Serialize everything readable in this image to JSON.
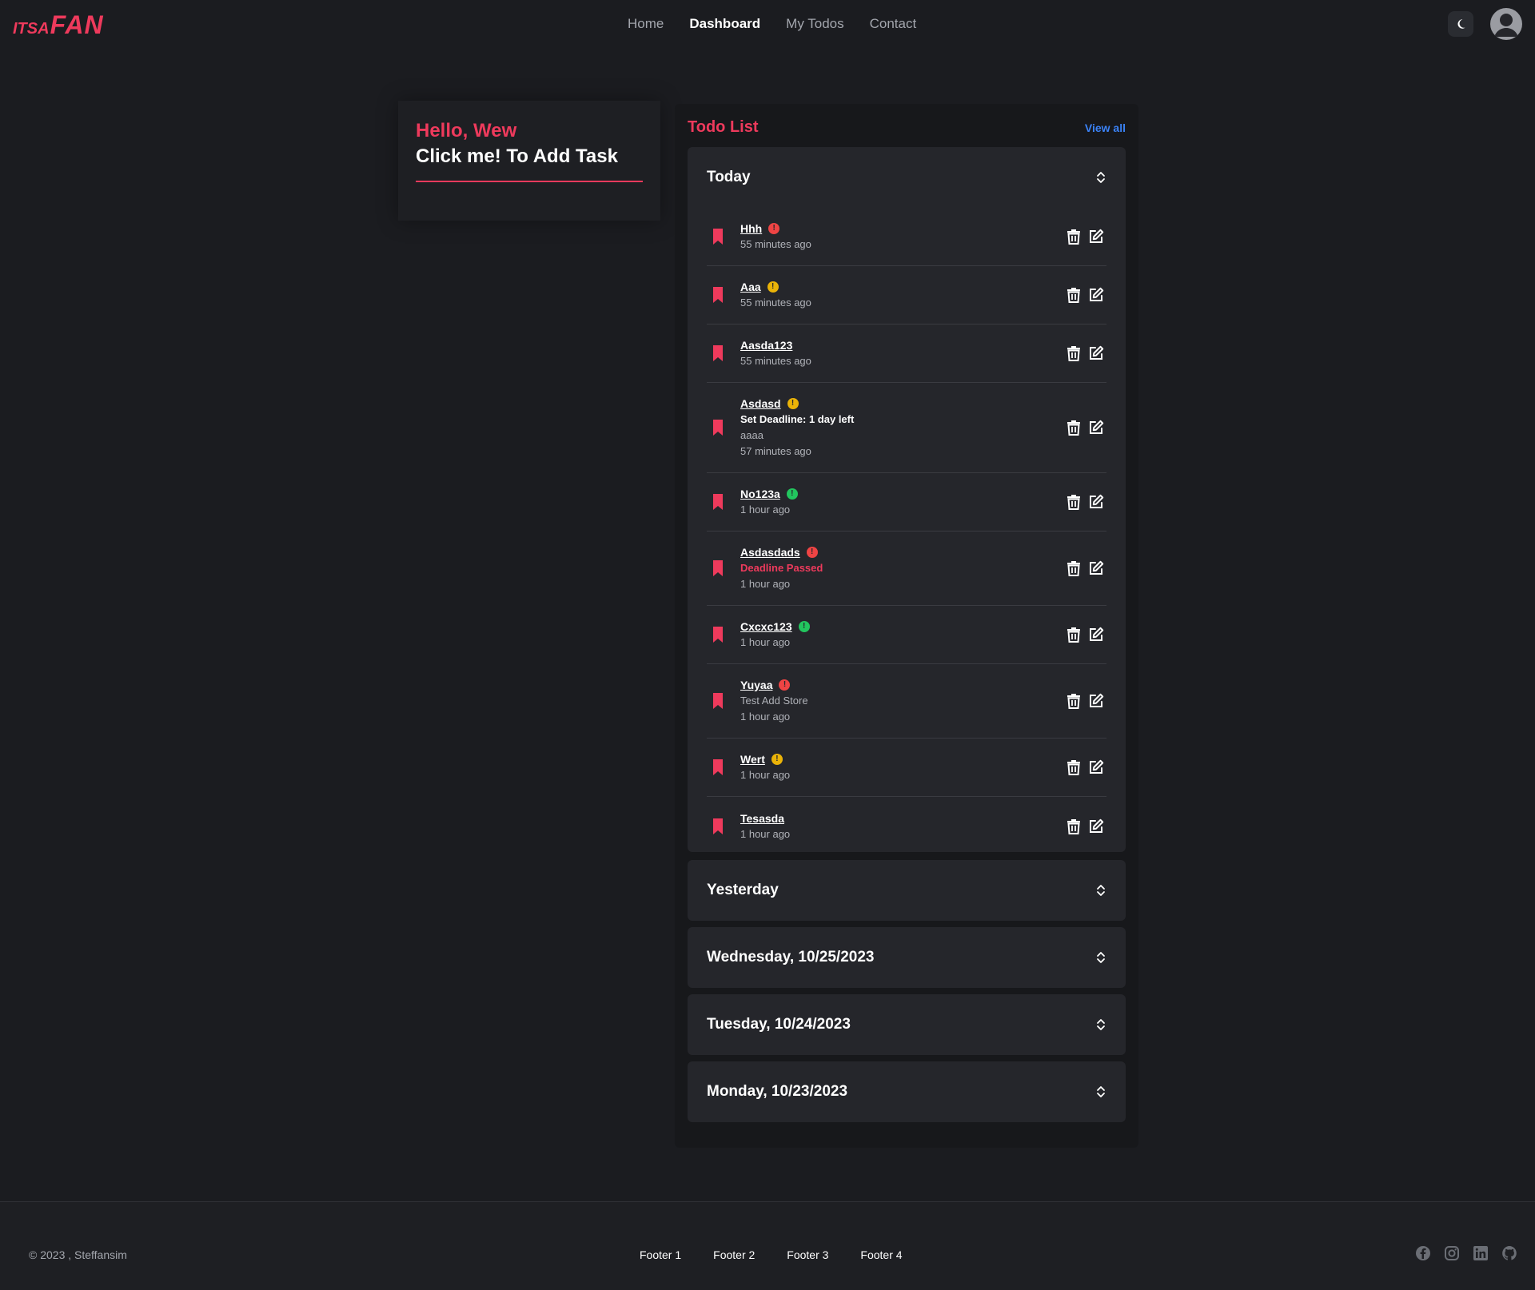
{
  "header": {
    "logo_small": "ITSA",
    "logo_big": "FAN",
    "nav": [
      {
        "label": "Home",
        "active": false
      },
      {
        "label": "Dashboard",
        "active": true
      },
      {
        "label": "My Todos",
        "active": false
      },
      {
        "label": "Contact",
        "active": false
      }
    ],
    "theme_icon": "moon-icon",
    "avatar_icon": "user-avatar-icon"
  },
  "greeting": {
    "hello": "Hello, Wew",
    "add_task": "Click me! To Add Task"
  },
  "todo": {
    "title": "Todo List",
    "view_all": "View all",
    "groups": [
      {
        "title": "Today",
        "expanded": true,
        "items": [
          {
            "title": "Hhh",
            "priority": "high",
            "lines": [
              {
                "kind": "time",
                "text": "55 minutes ago"
              }
            ]
          },
          {
            "title": "Aaa",
            "priority": "medium",
            "lines": [
              {
                "kind": "time",
                "text": "55 minutes ago"
              }
            ]
          },
          {
            "title": "Aasda123",
            "priority": "none",
            "lines": [
              {
                "kind": "time",
                "text": "55 minutes ago"
              }
            ]
          },
          {
            "title": "Asdasd",
            "priority": "medium",
            "lines": [
              {
                "kind": "deadline",
                "text": "Set Deadline: 1 day left"
              },
              {
                "kind": "desc",
                "text": "aaaa"
              },
              {
                "kind": "time",
                "text": "57 minutes ago"
              }
            ]
          },
          {
            "title": "No123a",
            "priority": "low",
            "lines": [
              {
                "kind": "time",
                "text": "1 hour ago"
              }
            ]
          },
          {
            "title": "Asdasdads",
            "priority": "high",
            "lines": [
              {
                "kind": "passed",
                "text": "Deadline Passed"
              },
              {
                "kind": "time",
                "text": "1 hour ago"
              }
            ]
          },
          {
            "title": "Cxcxc123",
            "priority": "low",
            "lines": [
              {
                "kind": "time",
                "text": "1 hour ago"
              }
            ]
          },
          {
            "title": "Yuyaa",
            "priority": "high",
            "lines": [
              {
                "kind": "desc",
                "text": "Test Add Store"
              },
              {
                "kind": "time",
                "text": "1 hour ago"
              }
            ]
          },
          {
            "title": "Wert",
            "priority": "medium",
            "lines": [
              {
                "kind": "time",
                "text": "1 hour ago"
              }
            ]
          },
          {
            "title": "Tesasda",
            "priority": "none",
            "lines": [
              {
                "kind": "time",
                "text": "1 hour ago"
              }
            ]
          }
        ]
      },
      {
        "title": "Yesterday",
        "expanded": false,
        "items": []
      },
      {
        "title": "Wednesday, 10/25/2023",
        "expanded": false,
        "items": []
      },
      {
        "title": "Tuesday, 10/24/2023",
        "expanded": false,
        "items": []
      },
      {
        "title": "Monday, 10/23/2023",
        "expanded": false,
        "items": []
      }
    ]
  },
  "footer": {
    "copyright": "© 2023 , Steffansim",
    "links": [
      "Footer 1",
      "Footer 2",
      "Footer 3",
      "Footer 4"
    ],
    "socials": [
      "facebook-icon",
      "instagram-icon",
      "linkedin-icon",
      "github-icon"
    ]
  },
  "colors": {
    "accent": "#ee3a5c",
    "link": "#3b82f6",
    "priority_high": "#ef4444",
    "priority_medium": "#eab308",
    "priority_low": "#22c55e"
  }
}
